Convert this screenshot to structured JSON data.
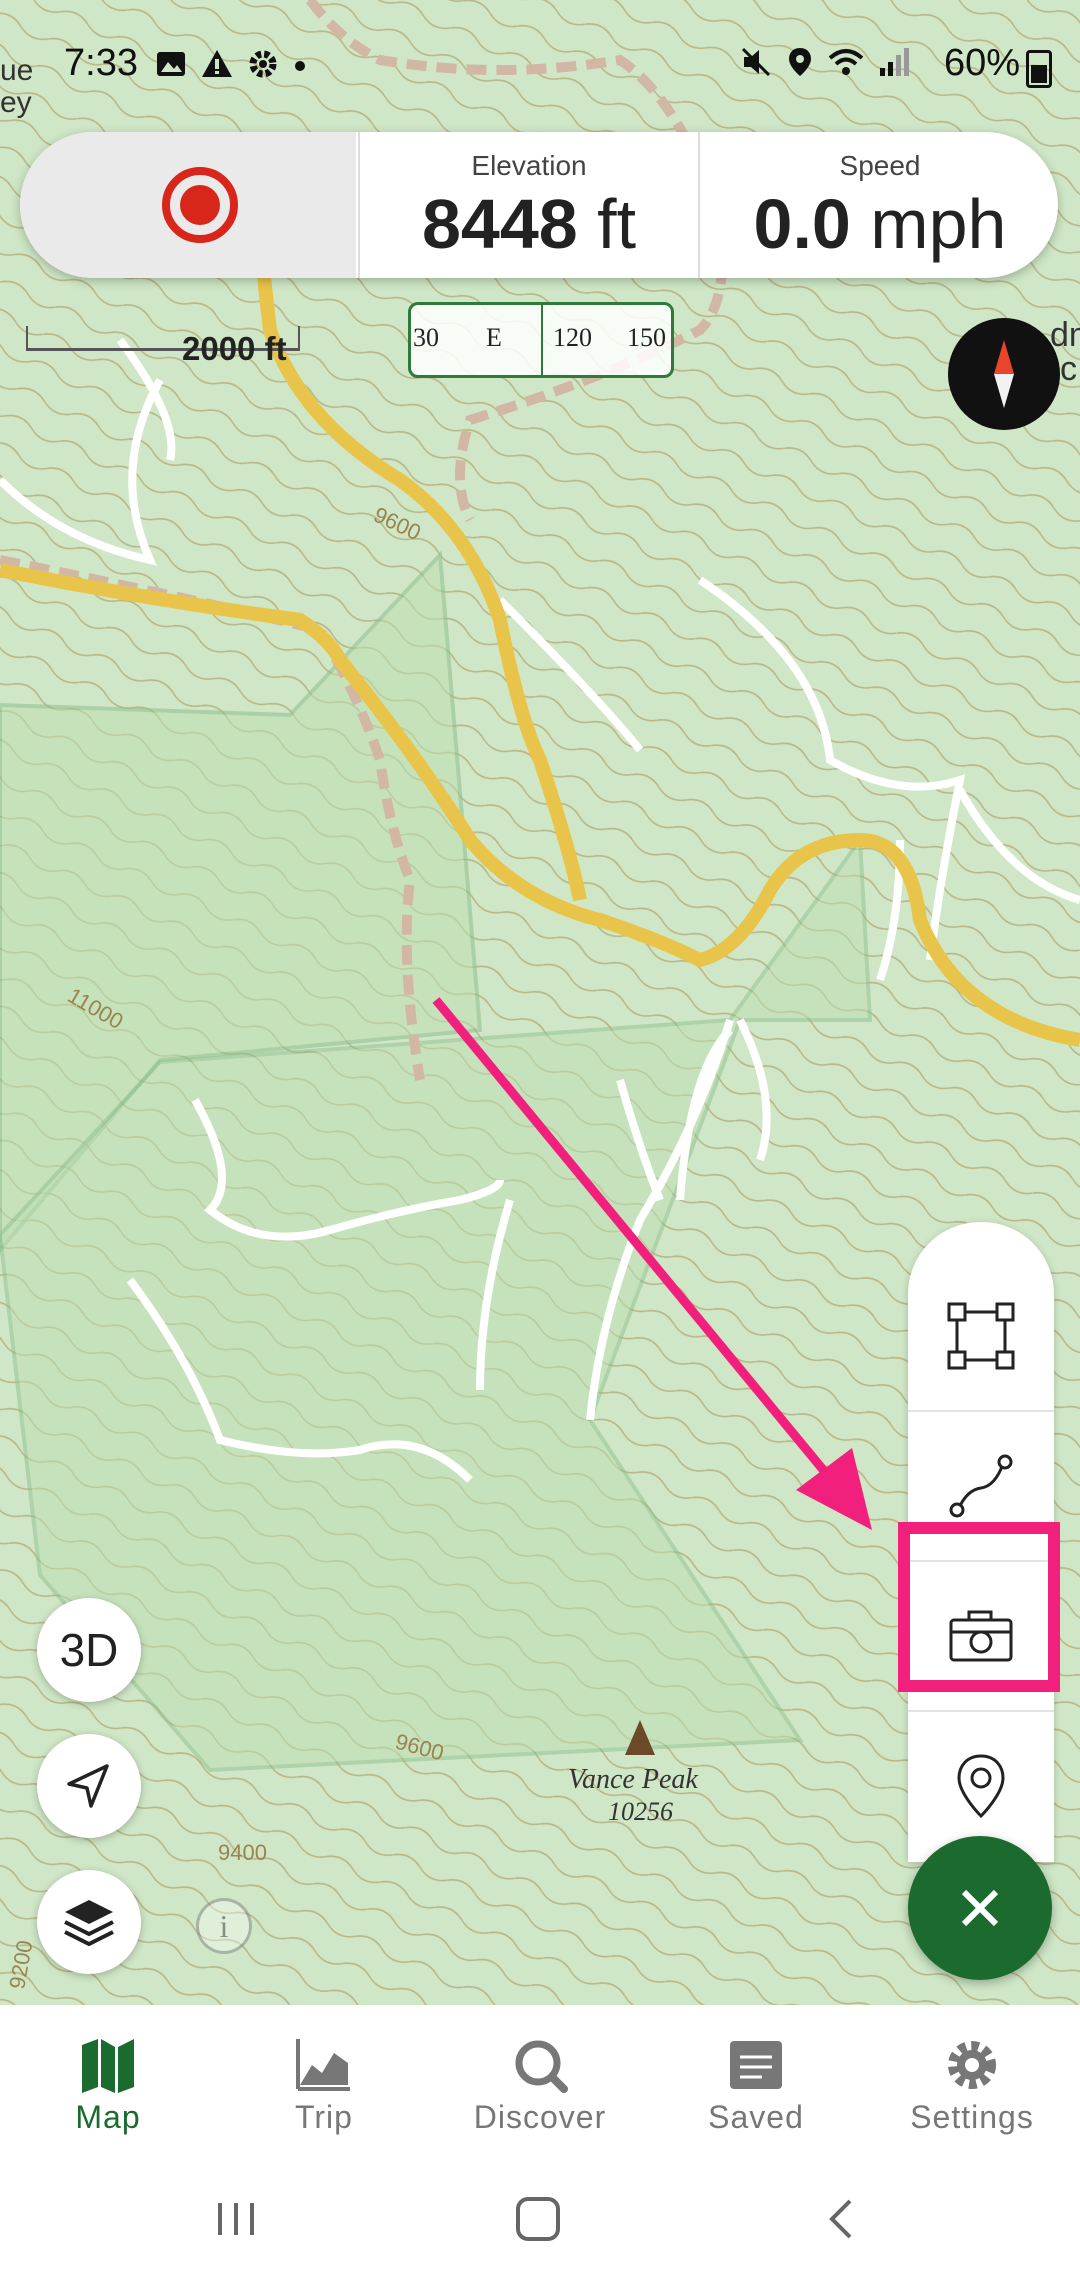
{
  "status_bar": {
    "time": "7:33",
    "battery": "60%"
  },
  "top_panel": {
    "elevation_label": "Elevation",
    "elevation_value": "8448",
    "elevation_unit": "ft",
    "speed_label": "Speed",
    "speed_value": "0.0",
    "speed_unit": "mph"
  },
  "map": {
    "scale_label": "2000 ft",
    "compass_strip": {
      "left": "30",
      "dir": "E",
      "mid": "120",
      "right": "150"
    },
    "peak_name": "Vance Peak",
    "peak_elevation": "10256",
    "contour_labels": [
      "9600",
      "11000",
      "9600",
      "9400",
      "9200"
    ],
    "edge_labels": [
      "ue",
      "ey",
      "dm",
      "c"
    ]
  },
  "map_controls": {
    "btn_3d": "3D",
    "info": "i"
  },
  "tools": [
    "area-tool",
    "route-tool",
    "photo-tool",
    "waypoint-tool"
  ],
  "tabs": [
    {
      "label": "Map",
      "icon": "map-icon",
      "active": true
    },
    {
      "label": "Trip",
      "icon": "chart-icon"
    },
    {
      "label": "Discover",
      "icon": "search-icon"
    },
    {
      "label": "Saved",
      "icon": "folder-icon"
    },
    {
      "label": "Settings",
      "icon": "gear-icon"
    }
  ],
  "colors": {
    "accent": "#1c6b2e",
    "highlight": "#f2207d",
    "record": "#d8261a",
    "map_bg": "#cfe7c6"
  }
}
